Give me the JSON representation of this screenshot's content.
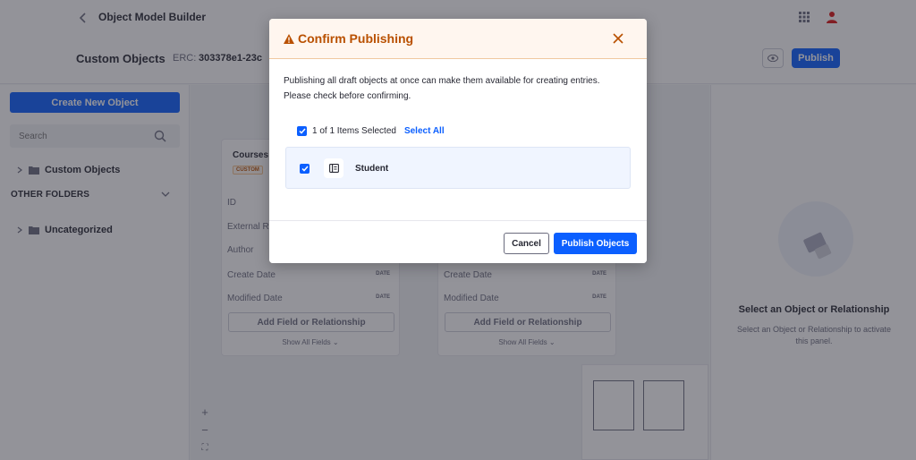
{
  "header": {
    "app_title": "Object Model Builder",
    "back_icon": "chevron-left-icon",
    "apps_icon": "grid-icon",
    "user_icon": "user-icon"
  },
  "subheader": {
    "title": "Custom Objects",
    "erc_label": "ERC:",
    "erc_value": "303378e1-23c",
    "preview_icon": "eye-icon",
    "publish_label": "Publish"
  },
  "sidebar": {
    "create_label": "Create New Object",
    "search_placeholder": "Search",
    "folders": [
      {
        "label": "Custom Objects"
      },
      {
        "label": "Uncategorized"
      }
    ],
    "section_label": "OTHER FOLDERS"
  },
  "canvas": {
    "cards": [
      {
        "title": "Courses",
        "tag": "CUSTOM",
        "fields": [
          {
            "name": "ID",
            "type": ""
          },
          {
            "name": "External R",
            "type": ""
          },
          {
            "name": "Author",
            "type": ""
          },
          {
            "name": "Create Date",
            "type": "DATE"
          },
          {
            "name": "Modified Date",
            "type": "DATE"
          }
        ],
        "add_field_label": "Add Field or Relationship",
        "show_all_label": "Show All Fields ⌄"
      },
      {
        "title": "",
        "tag": "",
        "fields": [
          {
            "name": "Create Date",
            "type": "DATE"
          },
          {
            "name": "Modified Date",
            "type": "DATE"
          }
        ],
        "add_field_label": "Add Field or Relationship",
        "show_all_label": "Show All Fields ⌄"
      }
    ],
    "zoom": {
      "in": "+",
      "out": "−",
      "fit": "⛶"
    }
  },
  "right_panel": {
    "empty_title": "Select an Object or Relationship",
    "empty_desc": "Select an Object or Relationship to activate this panel."
  },
  "modal": {
    "title": "Confirm Publishing",
    "description_line1": "Publishing all draft objects at once can make them available for creating entries.",
    "description_line2": "Please check before confirming.",
    "selected_count": "1 of 1 Items Selected",
    "select_all": "Select All",
    "items": [
      {
        "label": "Student",
        "icon": "object-icon"
      }
    ],
    "cancel_label": "Cancel",
    "confirm_label": "Publish Objects"
  },
  "colors": {
    "primary": "#0b5fff",
    "warning": "#b95000",
    "warning_bg": "#fff6ef"
  }
}
